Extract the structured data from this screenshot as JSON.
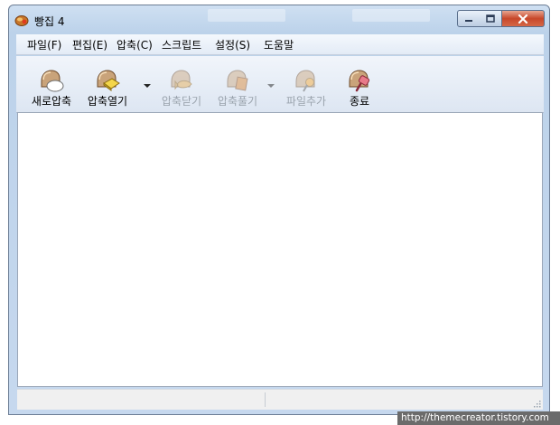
{
  "window": {
    "title": "빵집 4",
    "title_blur_text": [
      "",
      ""
    ]
  },
  "caption_buttons": {
    "minimize": "–",
    "maximize": "□",
    "close": "✕"
  },
  "menu": [
    {
      "label": "파일(F)"
    },
    {
      "label": "편집(E)"
    },
    {
      "label": "압축(C)"
    },
    {
      "label": "스크립트"
    },
    {
      "label": "설정(S)"
    },
    {
      "label": "도움말"
    }
  ],
  "toolbar": [
    {
      "label": "새로압축",
      "icon": "new-archive-icon",
      "enabled": true
    },
    {
      "label": "압축열기",
      "icon": "open-archive-icon",
      "enabled": true,
      "dropdown": true
    },
    {
      "label": "압축닫기",
      "icon": "close-archive-icon",
      "enabled": false
    },
    {
      "label": "압축풀기",
      "icon": "extract-icon",
      "enabled": false,
      "dropdown": true
    },
    {
      "label": "파일추가",
      "icon": "add-file-icon",
      "enabled": false
    },
    {
      "label": "종료",
      "icon": "exit-icon",
      "enabled": true
    }
  ],
  "watermark": "http://themecreator.tistory.com",
  "colors": {
    "frame": "#bcd2ea",
    "close_button": "#c7472a",
    "disabled_text": "#9aa3ad"
  }
}
